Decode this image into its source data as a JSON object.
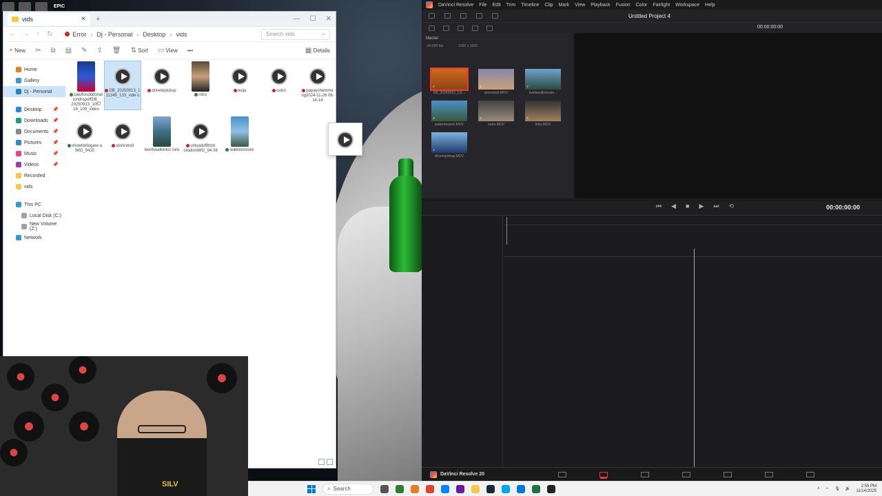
{
  "explorer": {
    "tab_title": "vids",
    "crumbs": [
      "Error",
      "Dj - Personal",
      "Desktop",
      "vids"
    ],
    "search_placeholder": "Search vids",
    "toolbar": {
      "new": "New",
      "sort": "Sort",
      "view": "View",
      "more": "•••",
      "details": "Details"
    },
    "nav": {
      "home": "Home",
      "gallery": "Gallery",
      "personal": "Dj - Personal",
      "desktop": "Desktop",
      "downloads": "Downloads",
      "documents": "Documents",
      "pictures": "Pictures",
      "music": "Music",
      "videos": "Videos",
      "recorded": "Recorded",
      "vids": "vids",
      "this_pc": "This PC",
      "local_disk": "Local Disk (C:)",
      "new_volume": "New Volume (Z:)",
      "network": "Network"
    },
    "files": [
      "zawifoodddonat iondropoffDB_ 20250913_1057 18_109_video",
      "DB_20250913_1 11349_133_vide o",
      "drivetopickup",
      "intro",
      "ouija",
      "outro",
      "papaychemme ng2024-11-26 08-14-14",
      "showfoldogare a IMG_9415",
      "storestroll",
      "twerkwalkintos tore",
      "unloadoffitstd onationIMG_94 08",
      "walkintostore"
    ]
  },
  "resolve": {
    "menu": [
      "DaVinci Resolve",
      "File",
      "Edit",
      "Trim",
      "Timeline",
      "Clip",
      "Mark",
      "View",
      "Playback",
      "Fusion",
      "Color",
      "Fairlight",
      "Workspace",
      "Help"
    ],
    "project_title": "Untitled Project 4",
    "viewer_timecode": "00:00:00:00",
    "timeline_timecode": "00:00:00:00",
    "pool_label": "Master",
    "fps": "60.000 fps",
    "resolution": "1080 x 1920",
    "clips": [
      "DB_20250913_111...",
      "storestroll.MOV",
      "twerkwalkintosto...",
      "walkintostore.MOV",
      "outro.MOV",
      "intro.MOV",
      "drivetopickup.MOV"
    ],
    "brand": "DaVinci Resolve 20"
  },
  "webcam": {
    "shirt_text": "SILV"
  },
  "taskbar": {
    "search_label": "Search",
    "time": "2:55 PM",
    "date": "11/14/2025"
  }
}
